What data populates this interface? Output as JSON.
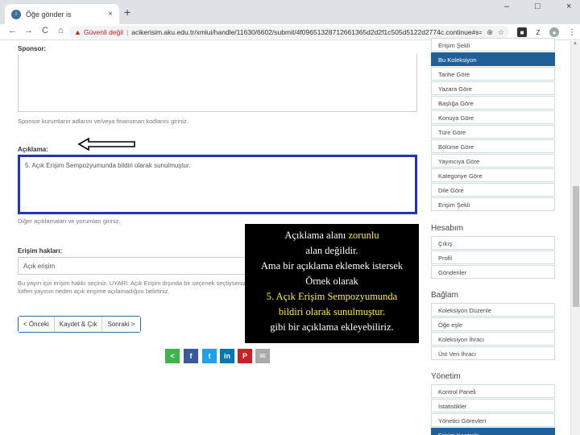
{
  "browser": {
    "tab_title": "Öğe gönder is",
    "favicon": "i",
    "tab_close": "×",
    "new_tab": "+",
    "window_controls": [
      "–",
      "□",
      "×"
    ],
    "insecure_label": "Güvenli değil",
    "url": "acikerisim.aku.edu.tr/xmlui/handle/11630/6602/submit/4f09651328712661365d2d2f1c505d5122d2774c.continue#s=ash...",
    "nav": {
      "back": "←",
      "forward": "→",
      "reload": "C",
      "home": "⌂"
    }
  },
  "form": {
    "sponsor_label": "Sponsor:",
    "sponsor_help": "Sponsor kurumların adlarını ve/veya finansman kodlarını giriniz.",
    "description_label": "Açıklama:",
    "description_value": "5. Açık Erişim Sempozyumunda bildiri olarak sunulmuştur.",
    "description_help": "Diğer açıklamaları ve yorumları giriniz.",
    "rights_label": "Erişim hakları:",
    "rights_value": "Açık erişim",
    "rights_help": "Bu yayın için erişim hakkı seçiniz. UYARI: Açık Erişim dışında bir seçenek seçtiyseniz lütfen yayının neden açık erişime açılamadığını belirtiniz.",
    "buttons": {
      "prev": "< Önceki",
      "save_exit": "Kaydet & Çık",
      "next": "Sonraki >"
    }
  },
  "share": {
    "icons": [
      "share-icon",
      "facebook-icon",
      "twitter-icon",
      "linkedin-icon",
      "pinterest-icon",
      "mail-icon"
    ]
  },
  "overlay": {
    "line1_a": "Açıklama alanı ",
    "line1_b": "zorunlu",
    "line2": "alan değildir.",
    "line3": "Ama bir açıklama eklemek istersek",
    "line4": "Örnek olarak",
    "line5": "5. Açık Erişim Sempozyumunda",
    "line6": "bildiri olarak sunulmuştur.",
    "line7": "gibi bir açıklama ekleyebiliriz."
  },
  "sidebar": {
    "browse": [
      "Erişim Şekli",
      "Bu Koleksiyon",
      "Tarihe Göre",
      "Yazara Göre",
      "Başlığa Göre",
      "Konuya Göre",
      "Türe Göre",
      "Bölüme Göre",
      "Yayıncıya Göre",
      "Kategoriye Göre",
      "Dile Göre",
      "Erişim Şekli"
    ],
    "account_heading": "Hesabım",
    "account": [
      "Çıkış",
      "Profil",
      "Gönderiler"
    ],
    "context_heading": "Bağlam",
    "context": [
      "Koleksiyon Düzenle",
      "Öğe eşle",
      "Koleksiyon İhracı",
      "Üst Veri İhracı"
    ],
    "admin_heading": "Yönetim",
    "admin": [
      "Kontrol Paneli",
      "İstatistikler",
      "Yönetici Görevleri",
      "Erişim Kontrolü"
    ]
  },
  "colors": {
    "accent": "#1f5f9a",
    "highlight_border": "#2233bb",
    "overlay_highlight": "#ffeb3b",
    "insecure": "#c5221f"
  }
}
